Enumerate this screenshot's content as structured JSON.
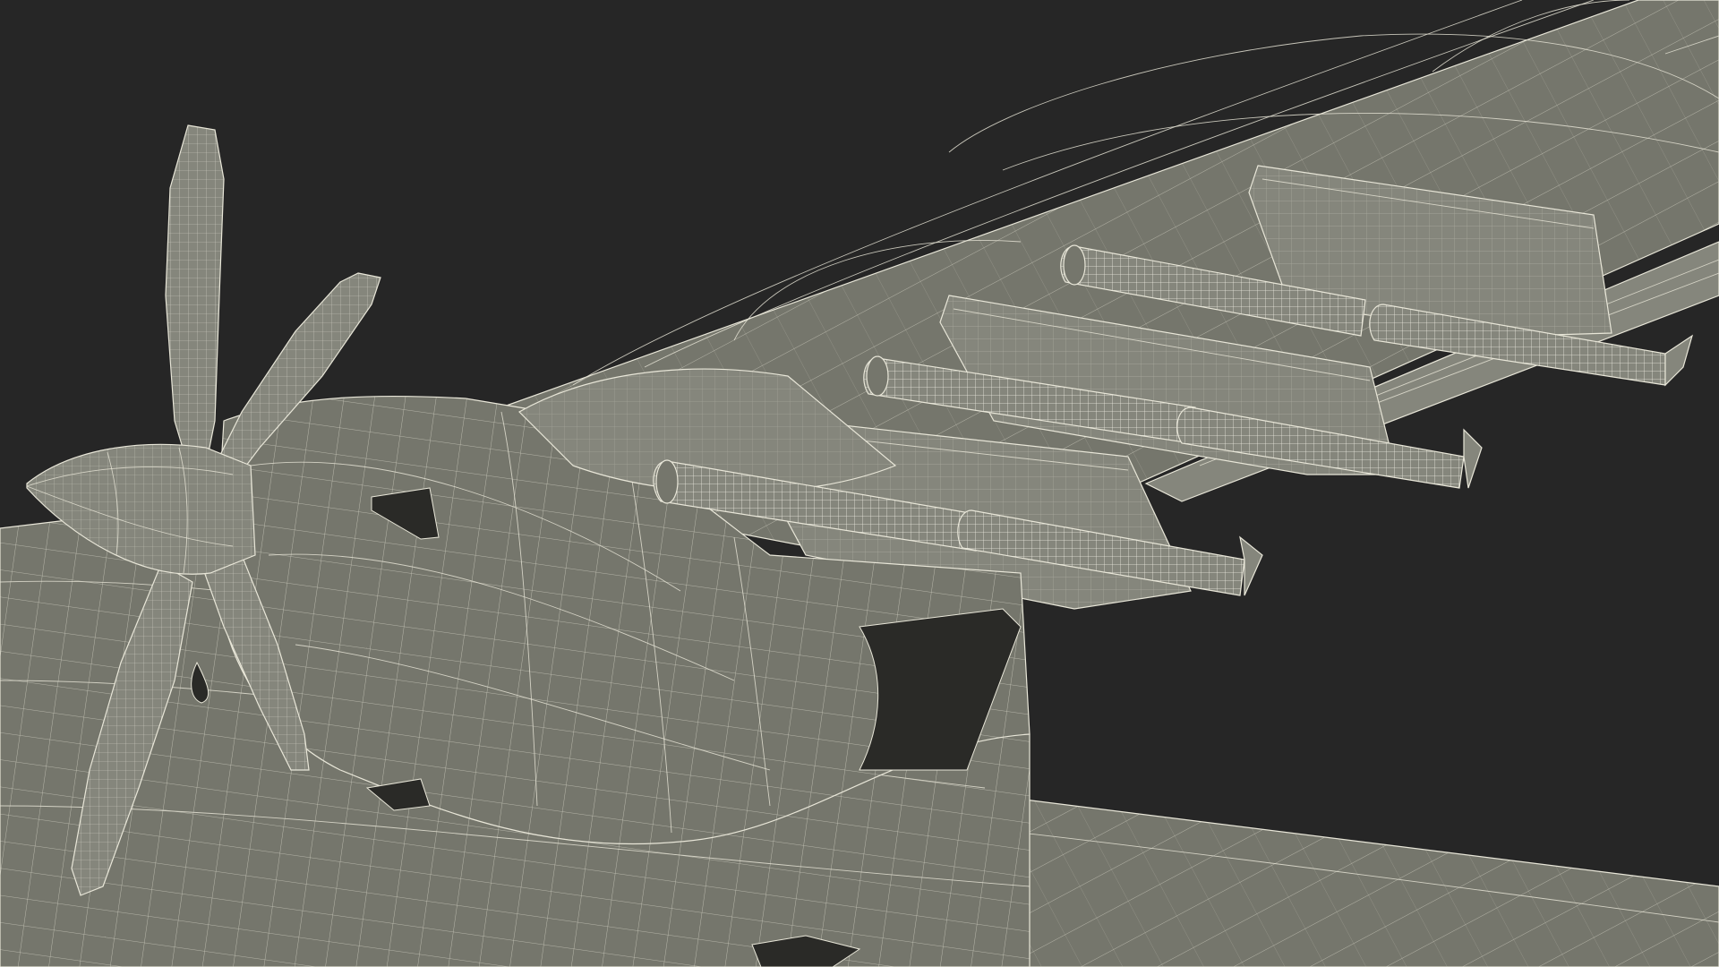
{
  "scene": {
    "background_color": "#262626",
    "surface_color": "#75766c",
    "wire_color": "#e8e6d8",
    "subject": "wireframe-aircraft-wing-with-pylon-stores"
  }
}
